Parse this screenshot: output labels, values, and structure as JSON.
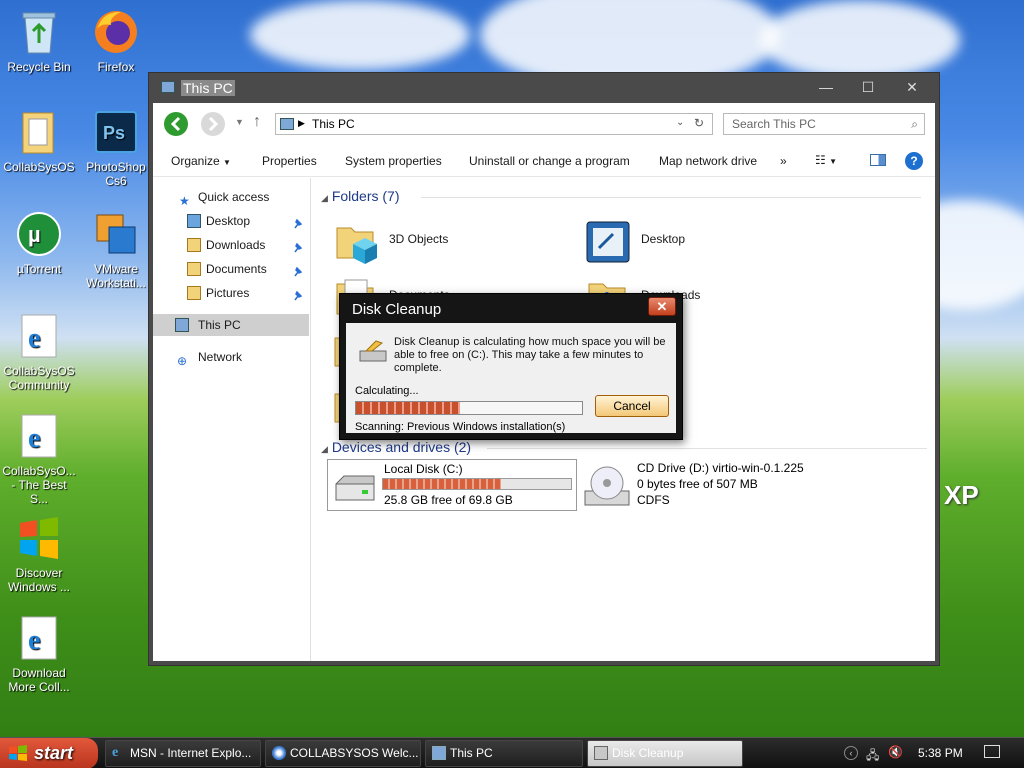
{
  "desktop": {
    "icons": [
      {
        "label": "Recycle Bin"
      },
      {
        "label": "Firefox"
      },
      {
        "label": "CollabSysOS"
      },
      {
        "label": "PhotoShop Cs6"
      },
      {
        "label": "µTorrent"
      },
      {
        "label": "VMware Workstati..."
      },
      {
        "label": "CollabSysOS Community"
      },
      {
        "label": "CollabSysO... - The Best S..."
      },
      {
        "label": "Discover Windows ..."
      },
      {
        "label": "Download More Coll..."
      }
    ],
    "xp_logo": "XP"
  },
  "explorer": {
    "title": "This PC",
    "address": "This PC",
    "search_placeholder": "Search This PC",
    "commands": {
      "organize": "Organize",
      "properties": "Properties",
      "system_properties": "System properties",
      "uninstall": "Uninstall or change a program",
      "map_drive": "Map network drive",
      "more": "»"
    },
    "nav": {
      "quick_access": "Quick access",
      "desktop": "Desktop",
      "downloads": "Downloads",
      "documents": "Documents",
      "pictures": "Pictures",
      "this_pc": "This PC",
      "network": "Network"
    },
    "folders_header": "Folders (7)",
    "folders": [
      "3D Objects",
      "Desktop",
      "Documents",
      "Downloads"
    ],
    "devices_header": "Devices and drives (2)",
    "drives": [
      {
        "name": "Local Disk (C:)",
        "free": "25.8 GB free of 69.8 GB",
        "used_fraction": 0.63
      },
      {
        "name": "CD Drive (D:) virtio-win-0.1.225",
        "free": "0 bytes free of 507 MB",
        "fs": "CDFS"
      }
    ]
  },
  "dialog": {
    "title": "Disk Cleanup",
    "message": "Disk Cleanup is calculating how much space you will be able to free on  (C:). This may take a few minutes to complete.",
    "calculating": "Calculating...",
    "progress_fraction": 0.46,
    "cancel": "Cancel",
    "scanning": "Scanning:   Previous Windows installation(s)"
  },
  "taskbar": {
    "start": "start",
    "items": [
      {
        "label": "MSN - Internet Explo..."
      },
      {
        "label": "COLLABSYSOS Welc..."
      },
      {
        "label": "This PC"
      },
      {
        "label": "Disk Cleanup"
      }
    ],
    "clock": "5:38 PM"
  },
  "colors": {
    "accent_blue": "#1e3a8a",
    "progress_orange": "#d9603c",
    "start_red": "#c8401f"
  }
}
